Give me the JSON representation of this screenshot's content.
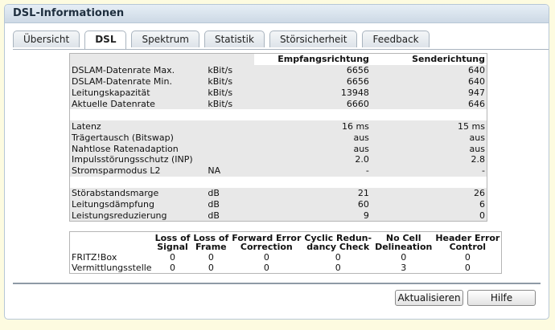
{
  "window": {
    "title": "DSL-Informationen"
  },
  "tabs": [
    {
      "label": "Übersicht",
      "active": false
    },
    {
      "label": "DSL",
      "active": true
    },
    {
      "label": "Spektrum",
      "active": false
    },
    {
      "label": "Statistik",
      "active": false
    },
    {
      "label": "Störsicherheit",
      "active": false
    },
    {
      "label": "Feedback",
      "active": false
    }
  ],
  "table1": {
    "headers": {
      "down": "Empfangsrichtung",
      "up": "Senderichtung"
    },
    "rows": [
      {
        "label": "DSLAM-Datenrate Max.",
        "unit": "kBit/s",
        "down": "6656",
        "up": "640"
      },
      {
        "label": "DSLAM-Datenrate Min.",
        "unit": "kBit/s",
        "down": "6656",
        "up": "640"
      },
      {
        "label": "Leitungskapazität",
        "unit": "kBit/s",
        "down": "13948",
        "up": "947"
      },
      {
        "label": "Aktuelle Datenrate",
        "unit": "kBit/s",
        "down": "6660",
        "up": "646"
      },
      {
        "label": "Latenz",
        "unit": "",
        "down": "16 ms",
        "up": "15 ms"
      },
      {
        "label": "Trägertausch (Bitswap)",
        "unit": "",
        "down": "aus",
        "up": "aus"
      },
      {
        "label": "Nahtlose Ratenadaption",
        "unit": "",
        "down": "aus",
        "up": "aus"
      },
      {
        "label": "Impulsstörungsschutz (INP)",
        "unit": "",
        "down": "2.0",
        "up": "2.8"
      },
      {
        "label": "Stromsparmodus L2",
        "unit": "NA",
        "down": "-",
        "up": "-"
      },
      {
        "label": "Störabstandsmarge",
        "unit": "dB",
        "down": "21",
        "up": "26"
      },
      {
        "label": "Leitungsdämpfung",
        "unit": "dB",
        "down": "60",
        "up": "6"
      },
      {
        "label": "Leistungsreduzierung",
        "unit": "dB",
        "down": "9",
        "up": "0"
      }
    ]
  },
  "table2": {
    "headers": [
      "Loss of Signal",
      "Loss of Frame",
      "Forward Error Correction",
      "Cyclic Redundancy Check",
      "No Cell Delineation",
      "Header Error Control"
    ],
    "header_lines": [
      [
        "Loss of",
        "Signal"
      ],
      [
        "Loss of",
        "Frame"
      ],
      [
        "Forward Error",
        "Correction"
      ],
      [
        "Cyclic Redun-",
        "dancy Check"
      ],
      [
        "No Cell",
        "Delineation"
      ],
      [
        "Header Error",
        "Control"
      ]
    ],
    "rows": [
      {
        "label": "FRITZ!Box",
        "values": [
          "0",
          "0",
          "0",
          "0",
          "0",
          "0"
        ]
      },
      {
        "label": "Vermittlungsstelle",
        "values": [
          "0",
          "0",
          "0",
          "0",
          "3",
          "0"
        ]
      }
    ]
  },
  "buttons": {
    "refresh": "Aktualisieren",
    "help": "Hilfe"
  }
}
